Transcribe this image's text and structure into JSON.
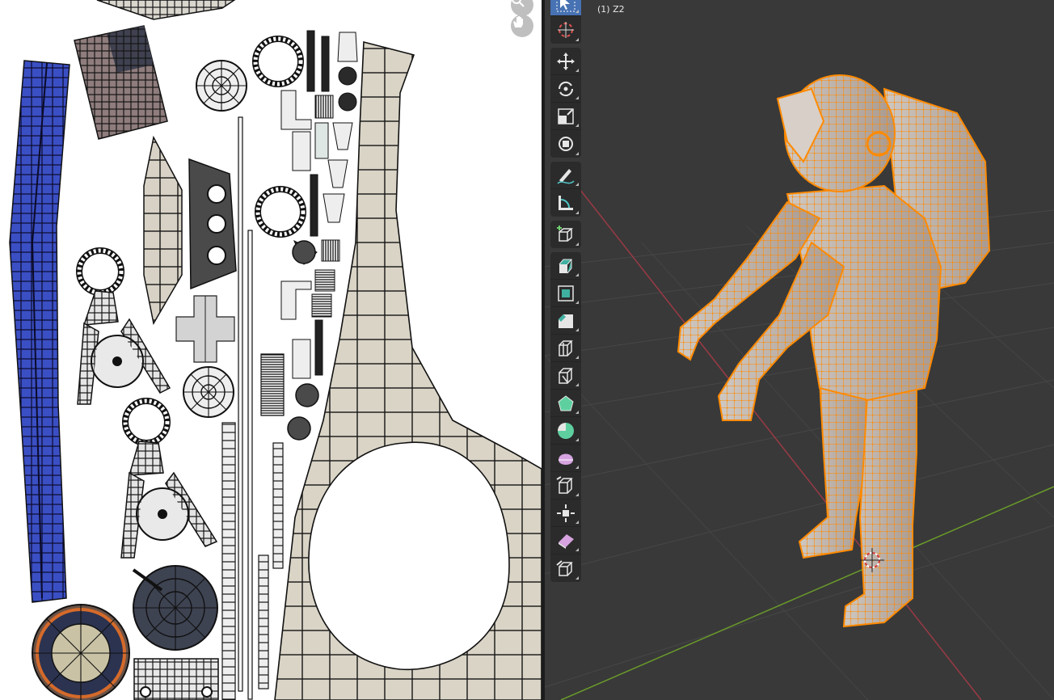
{
  "uv_editor": {
    "nav_buttons": [
      {
        "icon": "zoom-icon"
      },
      {
        "icon": "hand-pan-icon"
      }
    ]
  },
  "viewport": {
    "object_info": "(1) Z2",
    "selection_color": "#ff8a00",
    "grid_axis_x_color": "#9a3a45",
    "grid_axis_y_color": "#6a9a2a",
    "toolbar_groups": [
      [
        {
          "name": "tool-select-box",
          "icon": "select-box-icon",
          "active": true
        },
        {
          "name": "tool-cursor",
          "icon": "cursor-icon",
          "active": false
        }
      ],
      [
        {
          "name": "tool-move",
          "icon": "move-icon",
          "active": false
        },
        {
          "name": "tool-rotate",
          "icon": "rotate-icon",
          "active": false
        },
        {
          "name": "tool-scale",
          "icon": "scale-icon",
          "active": false
        },
        {
          "name": "tool-transform",
          "icon": "transform-icon",
          "active": false
        }
      ],
      [
        {
          "name": "tool-annotate",
          "icon": "annotate-icon",
          "active": false
        },
        {
          "name": "tool-measure",
          "icon": "measure-icon",
          "active": false
        }
      ],
      [
        {
          "name": "tool-add-cube",
          "icon": "add-cube-icon",
          "active": false
        }
      ],
      [
        {
          "name": "tool-extrude",
          "icon": "extrude-icon",
          "active": false
        },
        {
          "name": "tool-inset",
          "icon": "inset-faces-icon",
          "active": false
        },
        {
          "name": "tool-bevel",
          "icon": "bevel-icon",
          "active": false
        },
        {
          "name": "tool-loop-cut",
          "icon": "loop-cut-icon",
          "active": false
        },
        {
          "name": "tool-knife",
          "icon": "knife-icon",
          "active": false
        },
        {
          "name": "tool-poly-build",
          "icon": "poly-build-icon",
          "active": false
        },
        {
          "name": "tool-spin",
          "icon": "spin-icon",
          "active": false
        },
        {
          "name": "tool-smooth",
          "icon": "smooth-icon",
          "active": false
        },
        {
          "name": "tool-edge-slide",
          "icon": "edge-slide-icon",
          "active": false
        },
        {
          "name": "tool-shrink-fatten",
          "icon": "shrink-fatten-icon",
          "active": false
        },
        {
          "name": "tool-shear",
          "icon": "shear-icon",
          "active": false
        },
        {
          "name": "tool-rip-region",
          "icon": "rip-region-icon",
          "active": false
        }
      ]
    ]
  }
}
